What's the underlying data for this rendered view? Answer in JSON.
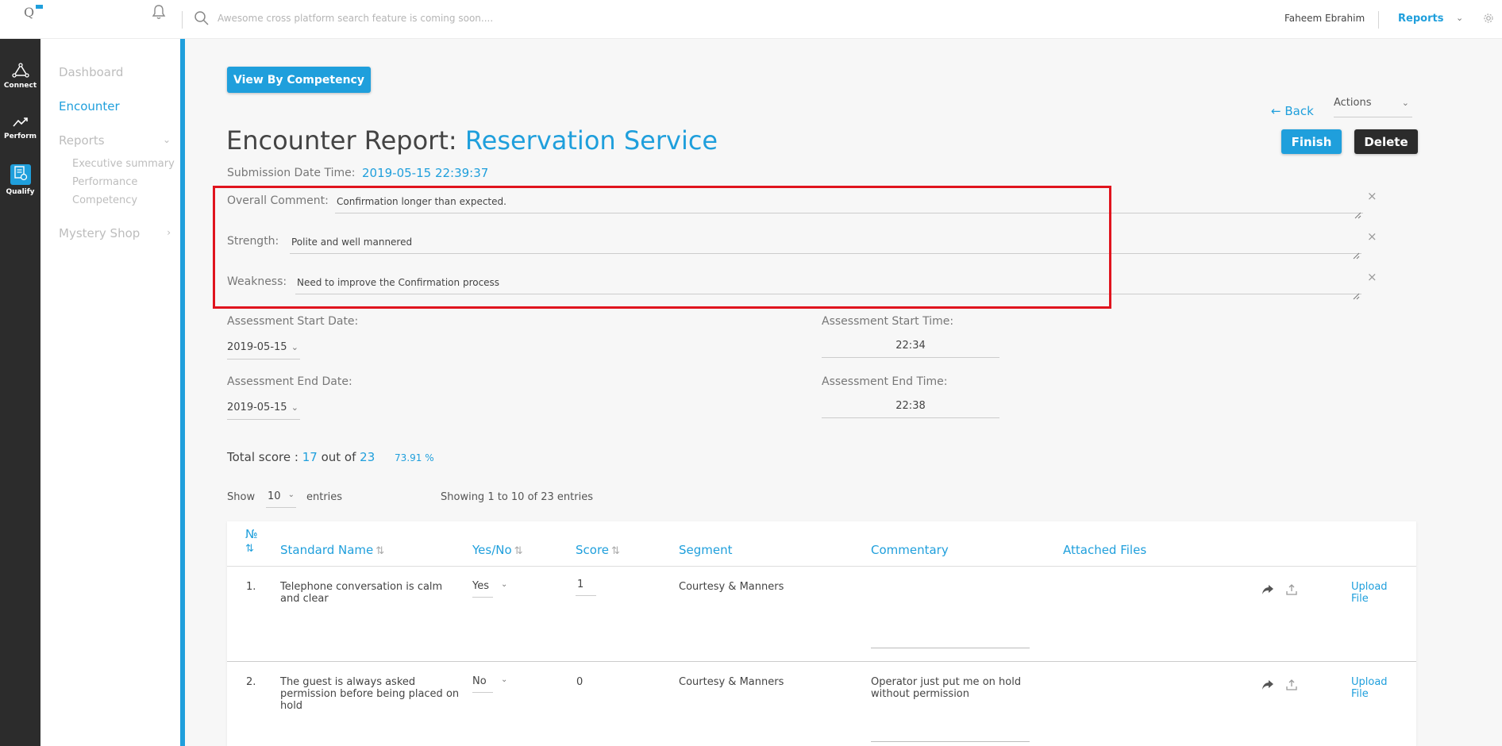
{
  "app": {
    "logo": "Q"
  },
  "search": {
    "placeholder": "Awesome cross platform search feature is coming soon...."
  },
  "user": {
    "name": "Faheem Ebrahim"
  },
  "top_nav": {
    "reports_label": "Reports"
  },
  "rail": [
    {
      "label": "Connect",
      "icon": "connect-icon"
    },
    {
      "label": "Perform",
      "icon": "trend-icon"
    },
    {
      "label": "Qualify",
      "icon": "qualify-icon",
      "active": true
    }
  ],
  "sidenav": {
    "dashboard": "Dashboard",
    "encounter": "Encounter",
    "reports": "Reports",
    "reports_sub": [
      "Executive summary",
      "Performance",
      "Competency"
    ],
    "mystery_shop": "Mystery Shop"
  },
  "toolbar": {
    "view_by_competency": "View By Competency",
    "back": "Back",
    "actions": "Actions",
    "finish": "Finish",
    "delete": "Delete"
  },
  "report": {
    "title_prefix": "Encounter Report:",
    "title_name": "Reservation Service",
    "submission_label": "Submission Date Time:",
    "submission_value": "2019-05-15 22:39:37"
  },
  "comments": {
    "overall_label": "Overall Comment:",
    "overall_value": "Confirmation longer than expected.",
    "strength_label": "Strength:",
    "strength_value": "Polite and well mannered",
    "weakness_label": "Weakness:",
    "weakness_value": "Need to improve the Confirmation process"
  },
  "assessment": {
    "start_date_label": "Assessment Start Date:",
    "start_date": "2019-05-15",
    "end_date_label": "Assessment End Date:",
    "end_date": "2019-05-15",
    "start_time_label": "Assessment Start Time:",
    "start_time": "22:34",
    "end_time_label": "Assessment End Time:",
    "end_time": "22:38"
  },
  "score": {
    "label": "Total score :",
    "value": "17",
    "out_of": "out of",
    "total": "23",
    "percent": "73.91 %"
  },
  "table_controls": {
    "show": "Show",
    "page_size": "10",
    "entries": "entries",
    "showing": "Showing 1 to 10 of 23 entries"
  },
  "table": {
    "headers": {
      "no": "№",
      "standard_name": "Standard Name",
      "yes_no": "Yes/No",
      "score": "Score",
      "segment": "Segment",
      "commentary": "Commentary",
      "attached_files": "Attached Files"
    },
    "rows": [
      {
        "no": "1.",
        "standard": "Telephone conversation is calm and clear",
        "answer": "Yes",
        "score": "1",
        "segment": "Courtesy & Manners",
        "commentary": "",
        "upload": "Upload File"
      },
      {
        "no": "2.",
        "standard": "The guest is always asked permission before being placed on hold",
        "answer": "No",
        "score": "0",
        "segment": "Courtesy & Manners",
        "commentary": "Operator just put me on hold without permission",
        "upload": "Upload File"
      }
    ]
  },
  "colors": {
    "accent": "#1f9fdc",
    "rail": "#2c2c2c",
    "highlight_box": "#e0141e",
    "delete_button": "#2b2b2b"
  }
}
